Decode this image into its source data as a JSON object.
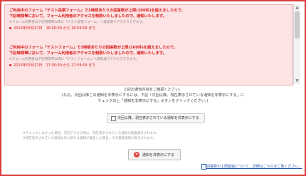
{
  "alerts": [
    {
      "heading_line1": "ご利用中のフォーム「テスト投票フォーム」で1時間あたりの回答数が上限(100件)を超えましたので、",
      "heading_line2": "下記時間帯において、フォーム利用者のアクセスを制限いたしましたので、通知いたします。",
      "note": "※フォーム利用者は下記時間帯以降に「テスト投票フォーム」へ通常通りアクセスできます。",
      "period": "2010年05月27日　16:00:00 から 16:59:59 まで"
    },
    {
      "heading_line1": "ご利用中のフォーム「テストフォーム」で1時間あたりの回答数が上限(100件)を超えましたので、",
      "heading_line2": "下記時間帯において、フォーム利用者のアクセスを制限いたしましたので、通知いたします。",
      "note": "※フォーム利用者は下記時間帯以降に「テストフォーム」へ通常通りアクセスできます。",
      "period": "2010年05月27日　17:00:00 から 17:59:59 まで"
    }
  ],
  "confirm": {
    "line1": "上記の通知内容をご確認ください。",
    "line2": "(なお、次回以降この通知を非表示にするには、下記「次回以降、現在表示されている通知を非表示にする」に",
    "line3": "チェックの上「通知を非表示にする」ボタンをクリックください。)"
  },
  "checkbox_label": "次回以降、現在表示されている通知を非表示にする",
  "notes": {
    "line1": "※チェックしなかった場合、次回アクセス時に、現在表示されている通知が再度表示されます。",
    "line2": "※現在表示されている通知以外に新たな通知が発生した場合、その都度通知が表示されます。"
  },
  "hide_button_label": "通知を非表示にする",
  "footer_link": "回答数の上限超過について、詳細はこちらをご覧ください。",
  "colors": {
    "accent": "#d92020",
    "panel_bg": "#fde3e3",
    "frame": "#d93c3c",
    "link": "#2a5db0"
  },
  "icons": {
    "close": "close-x-icon",
    "link": "document-icon"
  }
}
